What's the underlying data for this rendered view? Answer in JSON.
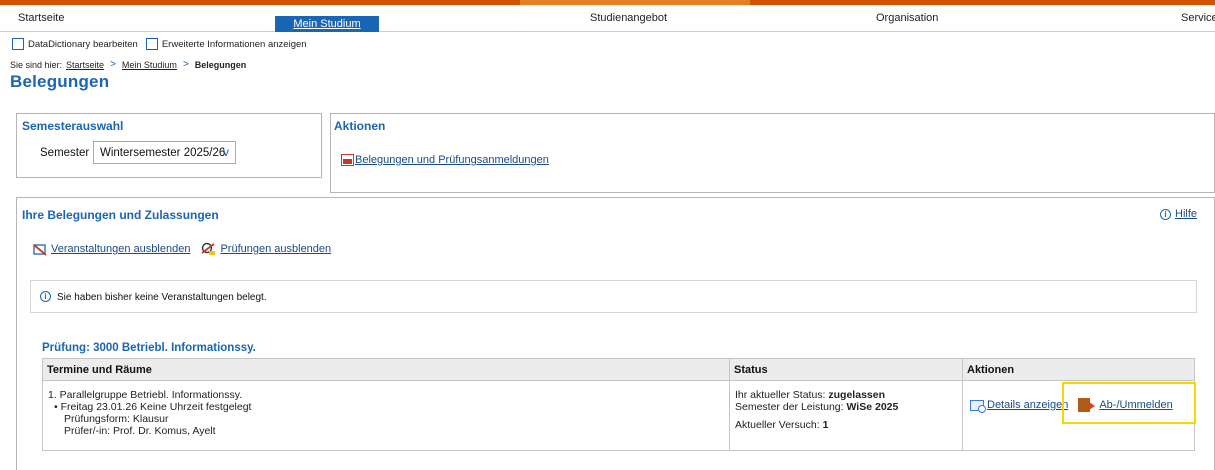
{
  "nav": {
    "items": [
      {
        "label": "Startseite"
      },
      {
        "label": "Mein Studium"
      },
      {
        "label": "Studienangebot"
      },
      {
        "label": "Organisation"
      },
      {
        "label": "Service"
      }
    ]
  },
  "options": {
    "datadictionary": "DataDictionary bearbeiten",
    "extended_info": "Erweiterte Informationen anzeigen"
  },
  "breadcrumb": {
    "prefix": "Sie sind hier:",
    "items": [
      "Startseite",
      "Mein Studium",
      "Belegungen"
    ],
    "separator": ">"
  },
  "page": {
    "title": "Belegungen"
  },
  "semester": {
    "title": "Semesterauswahl",
    "label": "Semester",
    "selected": "Wintersemester 2025/26",
    "chevron": "v"
  },
  "actions": {
    "title": "Aktionen",
    "link": "Belegungen und Prüfungsanmeldungen"
  },
  "enrollments": {
    "title": "Ihre Belegungen und Zulassungen",
    "help": "Hilfe",
    "help_icon": "i",
    "hide_courses": "Veranstaltungen ausblenden",
    "hide_exams": "Prüfungen ausblenden",
    "info_icon": "i",
    "info_message": "Sie haben bisher keine Veranstaltungen belegt."
  },
  "exam": {
    "title": "Prüfung: 3000 Betriebl. Informationssy.",
    "headers": {
      "terms": "Termine und Räume",
      "status": "Status",
      "actions": "Aktionen"
    },
    "row": {
      "group": "1. Parallelgruppe Betriebl. Informationssy.",
      "date": "• Freitag 23.01.26 Keine Uhrzeit festgelegt",
      "form": "Prüfungsform: Klausur",
      "examiner": "Prüfer/-in: Prof. Dr. Komus, Ayelt",
      "status_label": "Ihr aktueller Status:",
      "status_value": "zugelassen",
      "semester_label": "Semester der Leistung:",
      "semester_value": "WiSe 2025",
      "attempt_label": "Aktueller Versuch:",
      "attempt_value": "1",
      "details": "Details anzeigen",
      "unregister": "Ab-/Ummelden"
    }
  },
  "colors": {
    "accent": "#1a66b5",
    "brand_bar": "#d35400",
    "highlight": "#f5d800"
  },
  "icons": [
    "checkbox-icon",
    "pdf-icon",
    "info-icon",
    "hide-courses-icon",
    "hide-exams-icon",
    "details-icon",
    "unregister-icon",
    "chevron-down-icon"
  ]
}
